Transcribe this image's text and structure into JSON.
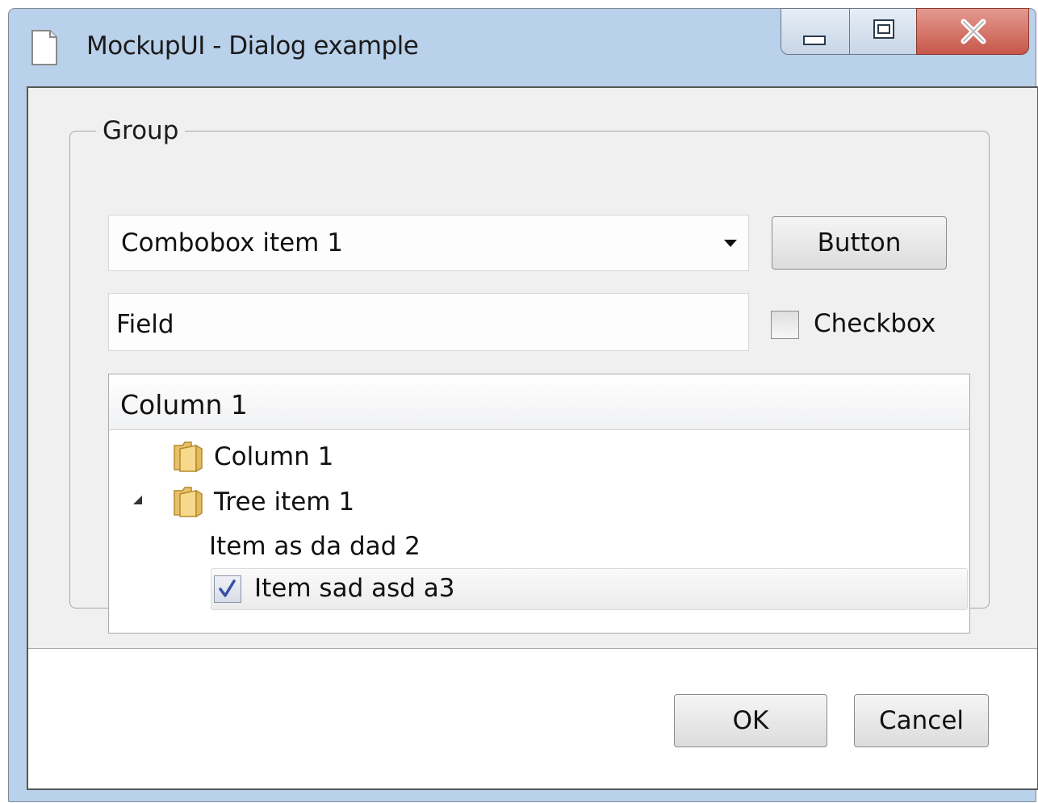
{
  "window": {
    "title": "MockupUI - Dialog example",
    "icon": "document-icon",
    "controls": [
      "minimize-icon",
      "maximize-icon",
      "close-icon"
    ]
  },
  "group": {
    "label": "Group"
  },
  "combobox": {
    "selected": "Combobox item 1"
  },
  "button": {
    "label": "Button"
  },
  "field": {
    "value": "Field"
  },
  "checkbox": {
    "label": "Checkbox",
    "checked": false
  },
  "tree": {
    "header": "Column 1",
    "items": [
      {
        "label": "Column 1",
        "icon": "folder-icon"
      },
      {
        "label": "Tree item 1",
        "icon": "folder-icon",
        "expanded": true
      },
      {
        "label": "Item as da dad 2"
      },
      {
        "label": "Item sad asd a3",
        "checked": true,
        "selected": true
      }
    ]
  },
  "footer": {
    "ok_label": "OK",
    "cancel_label": "Cancel"
  },
  "colors": {
    "titlebar": "#b9d1ea",
    "close_button": "#c7564a",
    "client": "#f0f0f0"
  }
}
